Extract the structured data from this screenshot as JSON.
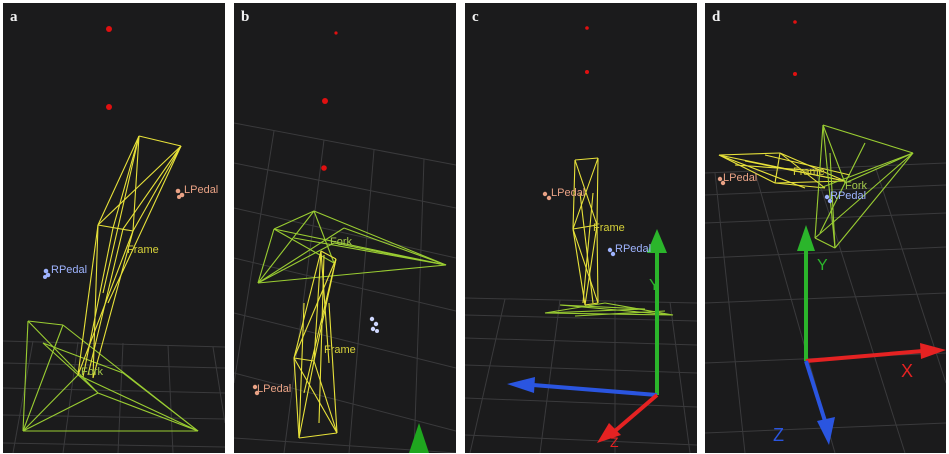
{
  "panels": [
    {
      "letter": "a",
      "labels": {
        "lpedal": "LPedal",
        "rpedal": "RPedal",
        "frame": "Frame",
        "fork": "Fork"
      }
    },
    {
      "letter": "b",
      "labels": {
        "fork": "Fork",
        "frame": "Frame",
        "lpedal": "LPedal"
      }
    },
    {
      "letter": "c",
      "labels": {
        "lpedal": "LPedal",
        "frame": "Frame",
        "rpedal": "RPedal",
        "axis_y": "Y",
        "axis_z": "Z"
      }
    },
    {
      "letter": "d",
      "labels": {
        "lpedal": "LPedal",
        "frame": "Frame",
        "fork": "Fork",
        "rpedal": "RPedal",
        "axis_y": "Y",
        "axis_x": "X",
        "axis_z": "Z"
      }
    }
  ],
  "colors": {
    "background": "#1b1b1c",
    "frame_yellow": "#e8e23a",
    "fork_green": "#9acd32",
    "marker_red": "#e01010",
    "axis_red": "#e52222",
    "axis_green": "#2bb52b",
    "axis_blue": "#2a55e0"
  }
}
